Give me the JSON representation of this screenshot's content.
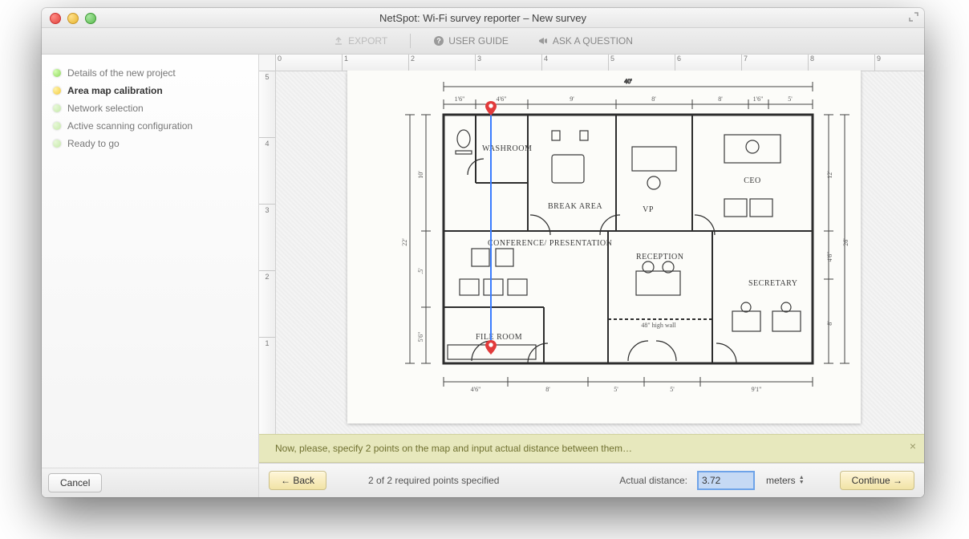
{
  "window": {
    "title": "NetSpot: Wi-Fi survey reporter – New survey"
  },
  "toolbar": {
    "export": "EXPORT",
    "user_guide": "USER GUIDE",
    "ask_question": "ASK A QUESTION"
  },
  "sidebar": {
    "steps": [
      {
        "label": "Details of the new project",
        "status": "done"
      },
      {
        "label": "Area map calibration",
        "status": "current"
      },
      {
        "label": "Network selection",
        "status": "pending"
      },
      {
        "label": "Active scanning configuration",
        "status": "pending"
      },
      {
        "label": "Ready to go",
        "status": "pending"
      }
    ],
    "cancel_label": "Cancel"
  },
  "ruler": {
    "h_ticks": [
      "0",
      "1",
      "2",
      "3",
      "4",
      "5",
      "6",
      "7",
      "8",
      "9"
    ],
    "v_ticks": [
      "5",
      "4",
      "3",
      "2",
      "1"
    ]
  },
  "floorplan": {
    "overall_width": "40'",
    "overall_depth": "26'",
    "rooms": {
      "washroom": "WASHROOM",
      "break_area": "BREAK AREA",
      "vp": "VP",
      "ceo": "CEO",
      "conference": "CONFERENCE/ PRESENTATION",
      "reception": "RECEPTION",
      "secretary": "SECRETARY",
      "file_room": "FILE ROOM"
    },
    "top_dims": [
      "1'6\"",
      "4'6\"",
      "9'",
      "8'",
      "8'",
      "1'6\"",
      "5'"
    ],
    "left_dims_outer": [
      "10'",
      ".5'",
      "5'6\""
    ],
    "left_main": "22'",
    "right_dims": [
      "12'",
      "4'6\"",
      "8'"
    ],
    "bottom_dims": [
      "4'6\"",
      "8'",
      "5'",
      "5'",
      "9'1\""
    ],
    "note": "48\" high wall"
  },
  "instruction": {
    "text": "Now, please, specify 2 points on the map and input actual distance between them…"
  },
  "footer": {
    "back_label": "← Back",
    "status": "2 of 2 required points specified",
    "distance_label": "Actual distance:",
    "distance_value": "3.72",
    "units_label": "meters",
    "continue_label": "Continue →"
  }
}
